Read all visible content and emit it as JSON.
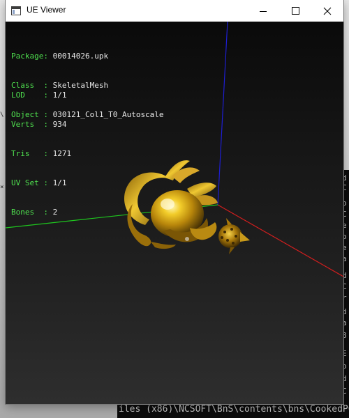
{
  "window": {
    "title": "UE Viewer"
  },
  "info_top": [
    {
      "key": "Package",
      "value": "00014026.upk"
    },
    {
      "key": "Class  ",
      "value": "SkeletalMesh"
    },
    {
      "key": "Object ",
      "value": "030121_Col1_T0_Autoscale"
    }
  ],
  "info_stats": [
    {
      "key": "LOD    ",
      "value": "1/1"
    },
    {
      "key": "Verts  ",
      "value": "934"
    },
    {
      "key": "Tris   ",
      "value": "1271"
    },
    {
      "key": "UV Set ",
      "value": "1/1"
    },
    {
      "key": "Bones  ",
      "value": "2"
    }
  ],
  "background_console": {
    "bottom_line": "iles (x86)\\NCSOFT\\BnS\\contents\\bns\\CookedPC"
  },
  "colors": {
    "label_green": "#4fe04f",
    "value_white": "#e8e8e8",
    "axis_x": "#d21e1e",
    "axis_y": "#1ec81e",
    "axis_z": "#1e1ed2",
    "mesh_gold": "#d4a017"
  }
}
